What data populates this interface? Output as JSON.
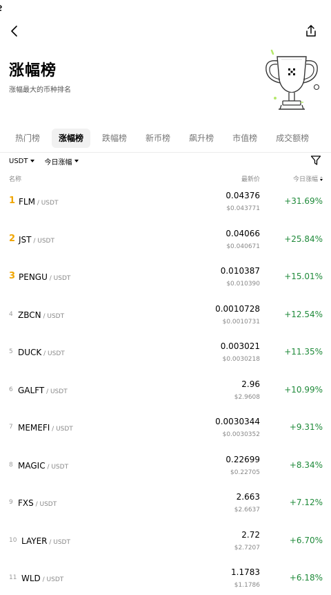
{
  "header": {
    "title": "涨幅榜",
    "subtitle": "涨幅最大的币种排名"
  },
  "icons": {
    "back": "chevron-left-icon",
    "share": "share-icon",
    "filter": "funnel-icon",
    "trophy": "trophy-illustration"
  },
  "tabs": [
    {
      "label": "热门榜",
      "active": false
    },
    {
      "label": "涨幅榜",
      "active": true
    },
    {
      "label": "跌幅榜",
      "active": false
    },
    {
      "label": "新币榜",
      "active": false
    },
    {
      "label": "飙升榜",
      "active": false
    },
    {
      "label": "市值榜",
      "active": false
    },
    {
      "label": "成交额榜",
      "active": false
    }
  ],
  "filters": {
    "quote": "USDT",
    "period": "今日涨幅"
  },
  "columns": {
    "name": "名称",
    "price": "最新价",
    "change": "今日涨幅"
  },
  "colors": {
    "rank_top": "#f0a500",
    "positive": "#1f8a3a",
    "trophy_accent": "#b5e86b"
  },
  "rows": [
    {
      "rank": "1",
      "base": "FLM",
      "quote": " / USDT",
      "price": "0.04376",
      "price_usd": "$0.043771",
      "change": "+31.69%"
    },
    {
      "rank": "2",
      "base": "JST",
      "quote": " / USDT",
      "price": "0.04066",
      "price_usd": "$0.040671",
      "change": "+25.84%"
    },
    {
      "rank": "3",
      "base": "PENGU",
      "quote": " / USDT",
      "price": "0.010387",
      "price_usd": "$0.010390",
      "change": "+15.01%"
    },
    {
      "rank": "4",
      "base": "ZBCN",
      "quote": " / USDT",
      "price": "0.0010728",
      "price_usd": "$0.0010731",
      "change": "+12.54%"
    },
    {
      "rank": "5",
      "base": "DUCK",
      "quote": " / USDT",
      "price": "0.003021",
      "price_usd": "$0.0030218",
      "change": "+11.35%"
    },
    {
      "rank": "6",
      "base": "GALFT",
      "quote": " / USDT",
      "price": "2.96",
      "price_usd": "$2.9608",
      "change": "+10.99%"
    },
    {
      "rank": "7",
      "base": "MEMEFI",
      "quote": " / USDT",
      "price": "0.0030344",
      "price_usd": "$0.0030352",
      "change": "+9.31%"
    },
    {
      "rank": "8",
      "base": "MAGIC",
      "quote": " / USDT",
      "price": "0.22699",
      "price_usd": "$0.22705",
      "change": "+8.34%"
    },
    {
      "rank": "9",
      "base": "FXS",
      "quote": " / USDT",
      "price": "2.663",
      "price_usd": "$2.6637",
      "change": "+7.12%"
    },
    {
      "rank": "10",
      "base": "LAYER",
      "quote": " / USDT",
      "price": "2.72",
      "price_usd": "$2.7207",
      "change": "+6.70%"
    },
    {
      "rank": "11",
      "base": "WLD",
      "quote": " / USDT",
      "price": "1.1783",
      "price_usd": "$1.1786",
      "change": "+6.18%"
    }
  ]
}
